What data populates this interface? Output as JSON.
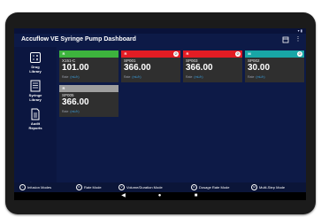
{
  "app": {
    "title": "Accuflow VE Syringe Pump Dashboard"
  },
  "colors": {
    "green": "#3db33d",
    "red": "#e21c24",
    "teal": "#18a6a6",
    "gray": "#9e9e9e",
    "background": "#0d1a47"
  },
  "sidebar": {
    "items": [
      {
        "label_line1": "Drug",
        "label_line2": "Library",
        "icon": "calculator-icon"
      },
      {
        "label_line1": "Syringe",
        "label_line2": "Library",
        "icon": "list-icon"
      },
      {
        "label_line1": "Audit",
        "label_line2": "Reports",
        "icon": "document-icon"
      }
    ],
    "sound_icon": "speaker-icon"
  },
  "pumps": [
    {
      "mode": "R",
      "name": "X151-C",
      "value": "101.00",
      "rate_label": "Rate",
      "rate_unit": "(mL/h)",
      "color": "#3db33d",
      "alarm": false
    },
    {
      "mode": "R",
      "name": "SP001",
      "value": "366.00",
      "rate_label": "Rate",
      "rate_unit": "(mL/h)",
      "color": "#e21c24",
      "alarm": true
    },
    {
      "mode": "R",
      "name": "SP003",
      "value": "366.00",
      "rate_label": "Rate",
      "rate_unit": "(mL/h)",
      "color": "#e21c24",
      "alarm": true
    },
    {
      "mode": "M",
      "name": "SP002",
      "value": "30.00",
      "rate_label": "Rate",
      "rate_unit": "(mL/h)",
      "color": "#18a6a6",
      "alarm": true
    },
    {
      "mode": "R",
      "name": "SP005",
      "value": "366.00",
      "rate_label": "Rate",
      "rate_unit": "(mL/h)",
      "color": "#9e9e9e",
      "alarm": false
    }
  ],
  "legend": [
    {
      "symbol": "",
      "label": "Infusion Modes"
    },
    {
      "symbol": "R",
      "label": "Rate Mode"
    },
    {
      "symbol": "V",
      "label": "Volume/Duration Mode"
    },
    {
      "symbol": "D",
      "label": "Dosage Rate Mode"
    },
    {
      "symbol": "M",
      "label": "Multi-Step Mode"
    }
  ],
  "navbar": {
    "back": "◀",
    "home": "●",
    "recents": "■"
  }
}
